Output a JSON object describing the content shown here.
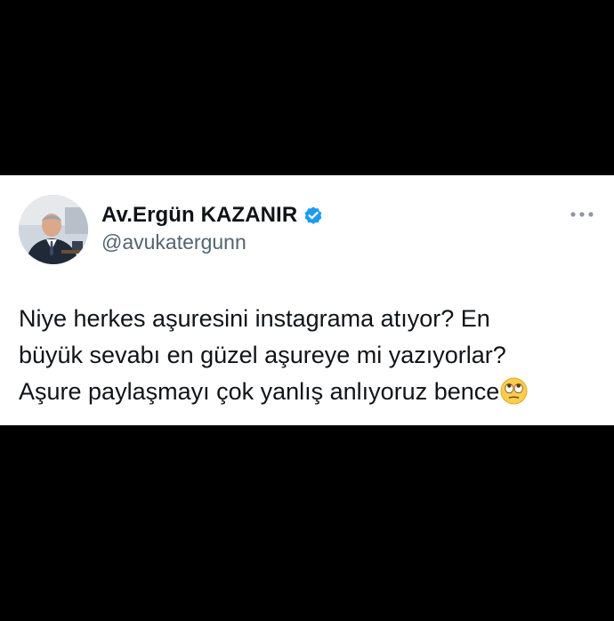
{
  "tweet": {
    "author": {
      "display_name": "Av.Ergün KAZANIR",
      "handle": "@avukatergunn",
      "verified": true,
      "avatar_icon": "profile-photo"
    },
    "text_lines": [
      "Niye herkes aşuresini instagrama atıyor? En",
      "büyük sevabı en güzel aşureye mi yazıyorlar?",
      "Aşure paylaşmayı çok yanlış anlıyoruz bence"
    ],
    "trailing_emoji": "rolling-eyes-emoji",
    "more_icon": "more-options-icon"
  },
  "colors": {
    "background": "#000000",
    "card": "#ffffff",
    "text_primary": "#0f1419",
    "text_secondary": "#536471",
    "verified_badge": "#1d9bf0"
  }
}
